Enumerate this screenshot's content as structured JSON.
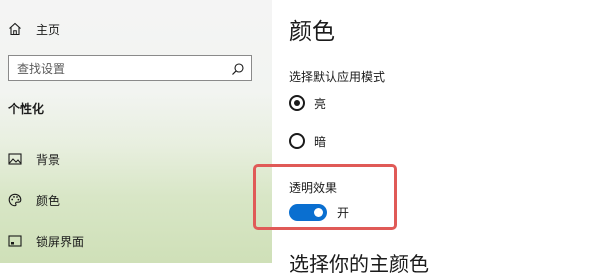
{
  "sidebar": {
    "home_label": "主页",
    "search_placeholder": "查找设置",
    "section_title": "个性化",
    "items": [
      {
        "label": "背景",
        "icon": "picture-icon"
      },
      {
        "label": "颜色",
        "icon": "palette-icon"
      },
      {
        "label": "锁屏界面",
        "icon": "lock-screen-icon"
      }
    ]
  },
  "main": {
    "title": "颜色",
    "mode_heading": "选择默认应用模式",
    "mode_options": [
      {
        "label": "亮",
        "selected": true
      },
      {
        "label": "暗",
        "selected": false
      }
    ],
    "transparency_heading": "透明效果",
    "transparency_state": "开",
    "accent_heading": "选择你的主颜色"
  },
  "colors": {
    "toggle_on": "#0a6fd0",
    "highlight_border": "#e05a57"
  }
}
